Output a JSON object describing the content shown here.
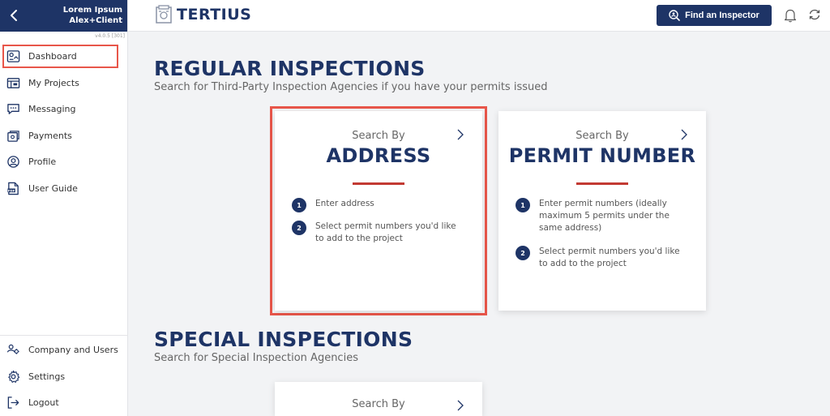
{
  "sidebar": {
    "user_line1": "Lorem Ipsum",
    "user_line2": "Alex+Client",
    "version": "v4.0.5 [301]",
    "items": [
      {
        "label": "Dashboard",
        "icon": "dashboard-icon"
      },
      {
        "label": "My Projects",
        "icon": "projects-icon"
      },
      {
        "label": "Messaging",
        "icon": "chat-icon"
      },
      {
        "label": "Payments",
        "icon": "payments-icon"
      },
      {
        "label": "Profile",
        "icon": "profile-icon"
      },
      {
        "label": "User Guide",
        "icon": "pdf-icon"
      }
    ],
    "bottom_items": [
      {
        "label": "Company and Users",
        "icon": "users-icon"
      },
      {
        "label": "Settings",
        "icon": "gear-icon"
      },
      {
        "label": "Logout",
        "icon": "logout-icon"
      }
    ]
  },
  "header": {
    "logo_text": "TERTIUS",
    "find_button": "Find an Inspector"
  },
  "regular": {
    "title": "REGULAR INSPECTIONS",
    "subtitle": "Search for Third-Party Inspection Agencies if you have your permits issued",
    "cards": [
      {
        "by": "Search By",
        "title": "ADDRESS",
        "steps": [
          {
            "num": "1",
            "text": "Enter address"
          },
          {
            "num": "2",
            "text": "Select permit numbers you'd like to add to the project"
          }
        ]
      },
      {
        "by": "Search By",
        "title": "PERMIT NUMBER",
        "steps": [
          {
            "num": "1",
            "text": "Enter permit numbers (ideally maximum 5 permits under the same address)"
          },
          {
            "num": "2",
            "text": "Select permit numbers you'd like to add to the project"
          }
        ]
      }
    ]
  },
  "special": {
    "title": "SPECIAL INSPECTIONS",
    "subtitle": "Search for Special Inspection Agencies",
    "cards": [
      {
        "by": "Search By"
      }
    ]
  },
  "colors": {
    "navy": "#1e3466",
    "highlight": "#e8564a",
    "rule": "#c23a33"
  }
}
